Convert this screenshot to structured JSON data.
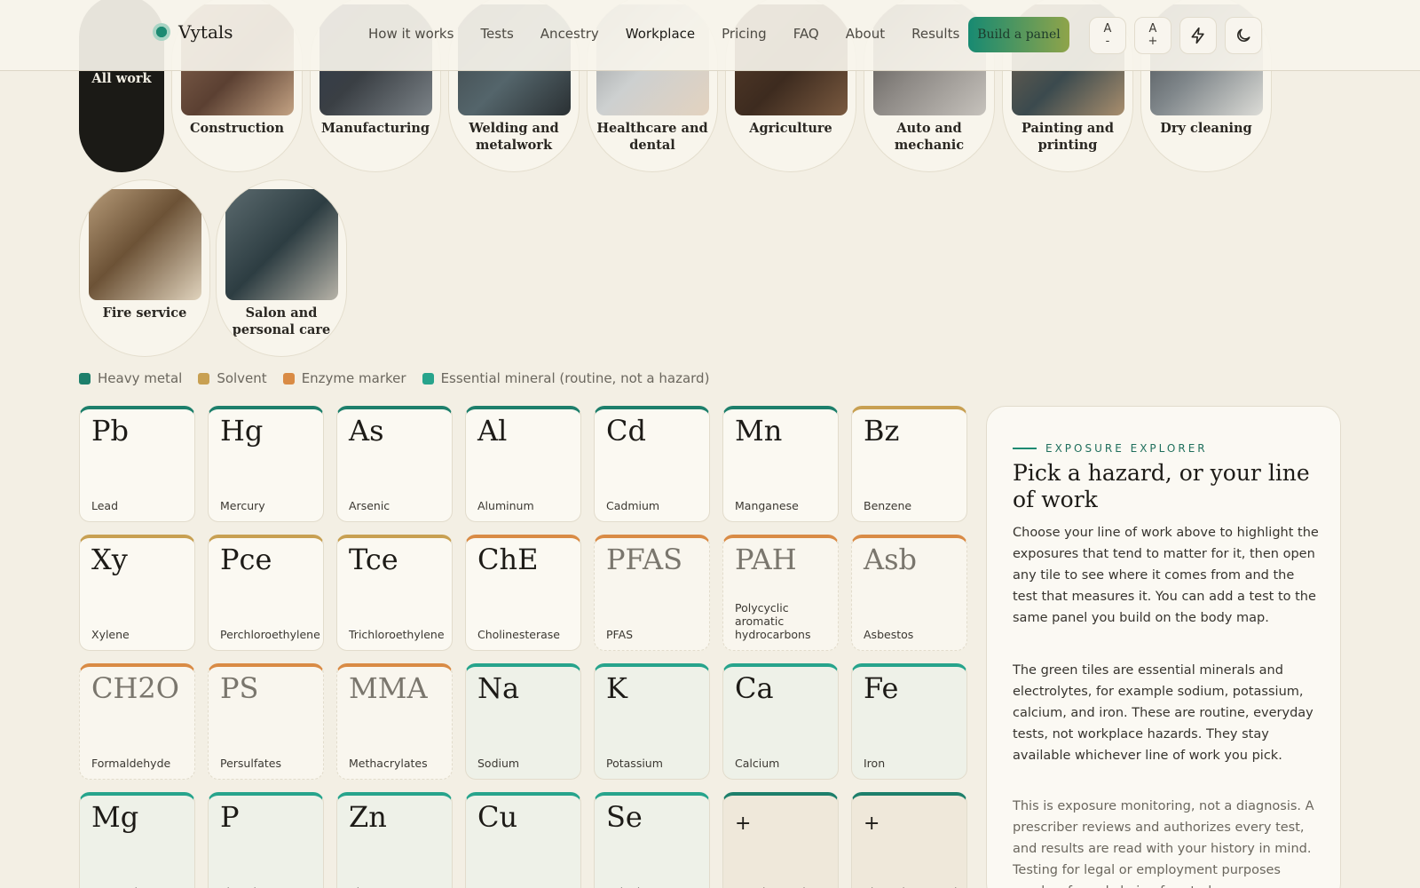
{
  "header": {
    "brand": "Vytals",
    "nav": [
      {
        "label": "How it works"
      },
      {
        "label": "Tests"
      },
      {
        "label": "Ancestry"
      },
      {
        "label": "Workplace",
        "active": true
      },
      {
        "label": "Pricing"
      },
      {
        "label": "FAQ"
      },
      {
        "label": "About"
      },
      {
        "label": "Results"
      }
    ],
    "cta_label": "Build a panel",
    "font_decrease": {
      "top": "A",
      "bottom": "-"
    },
    "font_increase": {
      "top": "A",
      "bottom": "+"
    },
    "quick_icon": "lightning-icon",
    "theme_icon": "moon-icon"
  },
  "categories": [
    {
      "label": "All work",
      "selected": true
    },
    {
      "label": "Construction"
    },
    {
      "label": "Manufacturing"
    },
    {
      "label": "Welding and metalwork"
    },
    {
      "label": "Healthcare and dental"
    },
    {
      "label": "Agriculture"
    },
    {
      "label": "Auto and mechanic"
    },
    {
      "label": "Painting and printing"
    },
    {
      "label": "Dry cleaning"
    },
    {
      "label": "Fire service"
    },
    {
      "label": "Salon and personal care"
    }
  ],
  "legend": [
    {
      "label": "Heavy metal",
      "color": "#1d7f6b"
    },
    {
      "label": "Solvent",
      "color": "#c8a052"
    },
    {
      "label": "Enzyme marker",
      "color": "#d98b45"
    },
    {
      "label": "Essential mineral (routine, not a hazard)",
      "color": "#27a48c"
    }
  ],
  "tiles": [
    {
      "symbol": "Pb",
      "name": "Lead",
      "kind": "metal"
    },
    {
      "symbol": "Hg",
      "name": "Mercury",
      "kind": "metal"
    },
    {
      "symbol": "As",
      "name": "Arsenic",
      "kind": "metal"
    },
    {
      "symbol": "Al",
      "name": "Aluminum",
      "kind": "metal"
    },
    {
      "symbol": "Cd",
      "name": "Cadmium",
      "kind": "metal"
    },
    {
      "symbol": "Mn",
      "name": "Manganese",
      "kind": "metal"
    },
    {
      "symbol": "Bz",
      "name": "Benzene",
      "kind": "solvent"
    },
    {
      "symbol": "Xy",
      "name": "Xylene",
      "kind": "solvent"
    },
    {
      "symbol": "Pce",
      "name": "Perchloroethylene",
      "kind": "solvent"
    },
    {
      "symbol": "Tce",
      "name": "Trichloroethylene",
      "kind": "solvent"
    },
    {
      "symbol": "ChE",
      "name": "Cholinesterase",
      "kind": "enzyme"
    },
    {
      "symbol": "PFAS",
      "name": "PFAS",
      "kind": "enzyme",
      "dashed": true
    },
    {
      "symbol": "PAH",
      "name": "Polycyclic aromatic hydrocarbons",
      "kind": "enzyme",
      "dashed": true
    },
    {
      "symbol": "Asb",
      "name": "Asbestos",
      "kind": "enzyme",
      "dashed": true
    },
    {
      "symbol": "CH2O",
      "name": "Formaldehyde",
      "kind": "enzyme",
      "dashed": true
    },
    {
      "symbol": "PS",
      "name": "Persulfates",
      "kind": "enzyme",
      "dashed": true
    },
    {
      "symbol": "MMA",
      "name": "Methacrylates",
      "kind": "enzyme",
      "dashed": true
    },
    {
      "symbol": "Na",
      "name": "Sodium",
      "kind": "mineral"
    },
    {
      "symbol": "K",
      "name": "Potassium",
      "kind": "mineral"
    },
    {
      "symbol": "Ca",
      "name": "Calcium",
      "kind": "mineral"
    },
    {
      "symbol": "Fe",
      "name": "Iron",
      "kind": "mineral"
    },
    {
      "symbol": "Mg",
      "name": "Magnesium",
      "kind": "mineral"
    },
    {
      "symbol": "P",
      "name": "Phosphate",
      "kind": "mineral"
    },
    {
      "symbol": "Zn",
      "name": "Zinc",
      "kind": "mineral"
    },
    {
      "symbol": "Cu",
      "name": "Copper",
      "kind": "mineral"
    },
    {
      "symbol": "Se",
      "name": "Selenium",
      "kind": "mineral"
    },
    {
      "symbol": "+",
      "name": "Metals panel",
      "kind": "panel"
    },
    {
      "symbol": "+",
      "name": "Electrolyte panel",
      "kind": "panel"
    }
  ],
  "explorer": {
    "kicker": "EXPOSURE EXPLORER",
    "title": "Pick a hazard, or your line of work",
    "para1": "Choose your line of work above to highlight the exposures that tend to matter for it, then open any tile to see where it comes from and the test that measures it. You can add a test to the same panel you build on the body map.",
    "para2": "The green tiles are essential minerals and electrolytes, for example sodium, potassium, calcium, and iron. These are routine, everyday tests, not workplace hazards. They stay available whichever line of work you pick.",
    "para3": "This is exposure monitoring, not a diagnosis. A prescriber reviews and authorizes every test, and results are read with your history in mind. Testing for legal or employment purposes needs a formal chain of custody."
  },
  "colors": {
    "metal": "#1d7f6b",
    "solvent": "#c8a052",
    "enzyme": "#d98b45",
    "mineral": "#27a48c",
    "panel": "#1d7f6b"
  }
}
